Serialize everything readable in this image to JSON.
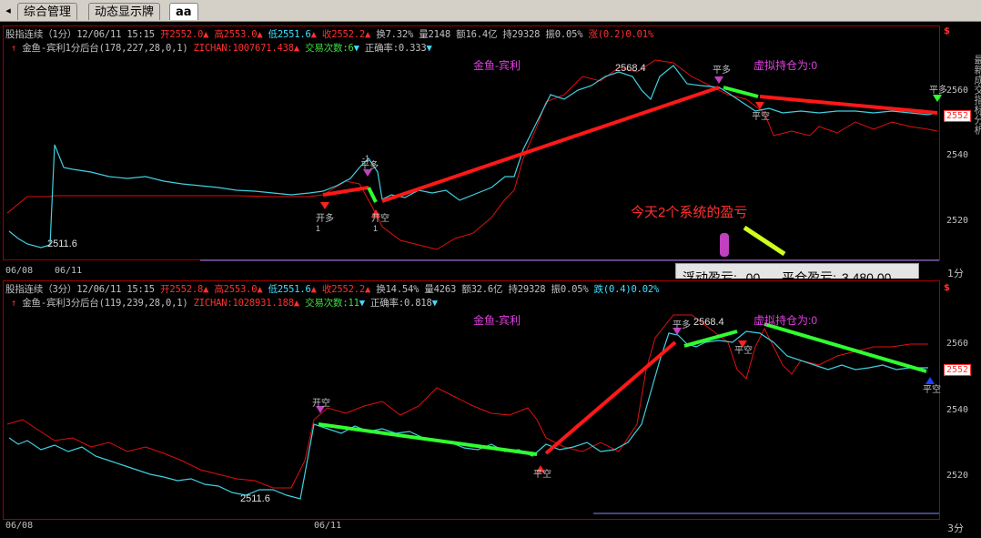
{
  "tabs": {
    "back_glyph": "◂",
    "items": [
      {
        "label": "综合管理",
        "active": false
      },
      {
        "label": "动态显示牌",
        "active": false
      },
      {
        "label": "aa",
        "active": true
      }
    ]
  },
  "panel1": {
    "header": {
      "title": "股指连续（1分）12/06/11 15:15",
      "open": "开2552.0",
      "high": "高2553.0",
      "low": "低2551.6",
      "close": "收2552.2",
      "turnover": "换7.32%",
      "volume": "量2148",
      "amount": "额16.4亿",
      "position": "持29328",
      "amplitude": "振0.05%",
      "change": "涨(0.2)0.01%"
    },
    "indicator": {
      "name": "金鱼-宾利1分后台(178,227,28,0,1)",
      "zichan": "ZICHAN:1007671.438",
      "trades": "交易次数:6",
      "accuracy": "正确率:0.333"
    },
    "labels": {
      "strategy": "金鱼-宾利",
      "virtual_pos": "虚拟持仓为:0",
      "peak": "2568.4",
      "low": "2511.6",
      "annotation": "今天2个系统的盈亏",
      "signal_open_long": "开多",
      "signal_close_long": "平多",
      "signal_open_short": "开空",
      "signal_close_short": "平空",
      "signal_num": "1",
      "signal_num_neg": "-1"
    },
    "axis": [
      "2560",
      "2540",
      "2520"
    ],
    "price_tag": "2552",
    "dates": [
      "06/08",
      "06/11"
    ],
    "period": "1分"
  },
  "pnl": {
    "floating_label": "浮动盈亏:",
    "floating_value": ".00",
    "closed_label": "平仓盈亏:",
    "closed_value": "3,480.00"
  },
  "panel2": {
    "header": {
      "title": "股指连续（3分）12/06/11 15:15",
      "open": "开2552.8",
      "high": "高2553.0",
      "low": "低2551.6",
      "close": "收2552.2",
      "turnover": "换14.54%",
      "volume": "量4263",
      "amount": "额32.6亿",
      "position": "持29328",
      "amplitude": "振0.05%",
      "change": "跌(0.4)0.02%"
    },
    "indicator": {
      "name": "金鱼-宾利3分后台(119,239,28,0,1)",
      "zichan": "ZICHAN:1028931.188",
      "trades": "交易次数:11",
      "accuracy": "正确率:0.818"
    },
    "labels": {
      "strategy": "金鱼-宾利",
      "virtual_pos": "虚拟持仓为:0",
      "peak": "2568.4",
      "low": "2511.6"
    },
    "axis": [
      "2560",
      "2540",
      "2520"
    ],
    "price_tag": "2552",
    "dates": [
      "06/08",
      "06/11"
    ],
    "period": "3分"
  },
  "side_text": "最新成交指标分析"
}
